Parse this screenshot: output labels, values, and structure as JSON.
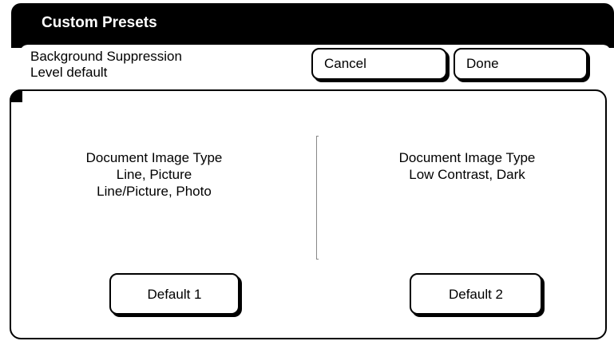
{
  "window": {
    "title": "Custom Presets"
  },
  "header": {
    "setting_line1": "Background Suppression",
    "setting_line2": "Level default",
    "cancel_label": "Cancel",
    "done_label": "Done"
  },
  "options": {
    "left": {
      "line1": "Document Image Type",
      "line2": "Line, Picture",
      "line3": "Line/Picture, Photo",
      "button_label": "Default 1"
    },
    "right": {
      "line1": "Document Image Type",
      "line2": "Low Contrast, Dark",
      "button_label": "Default 2"
    }
  },
  "colors": {
    "title_bar_bg": "#000000",
    "title_text": "#ffffff",
    "background": "#ffffff"
  }
}
